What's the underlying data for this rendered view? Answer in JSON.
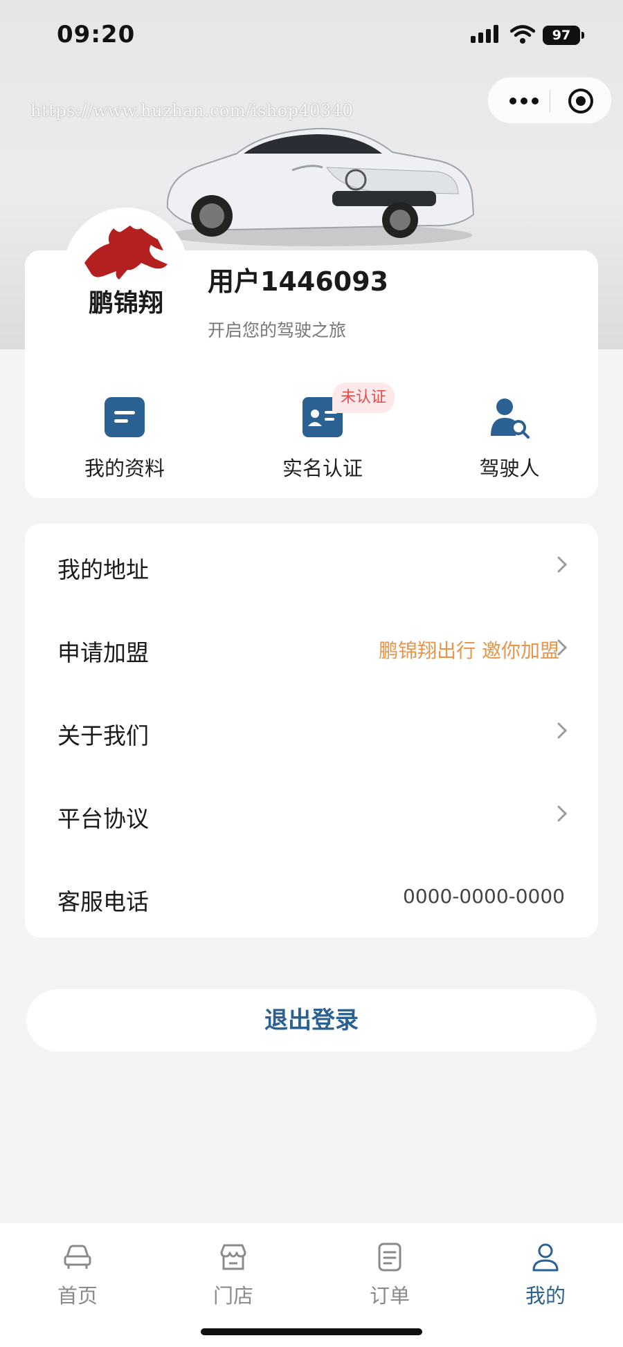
{
  "status_bar": {
    "time": "09:20",
    "battery": "97"
  },
  "header": {
    "watermark": "https://www.huzhan.com/ishop40340"
  },
  "profile": {
    "username": "用户1446093",
    "subtitle": "开启您的驾驶之旅",
    "logo_text": "鹏锦翔"
  },
  "shortcuts": [
    {
      "label": "我的资料"
    },
    {
      "label": "实名认证",
      "badge": "未认证"
    },
    {
      "label": "驾驶人"
    }
  ],
  "menu": [
    {
      "label": "我的地址",
      "value": ""
    },
    {
      "label": "申请加盟",
      "value": "鹏锦翔出行 邀你加盟"
    },
    {
      "label": "关于我们",
      "value": ""
    },
    {
      "label": "平台协议",
      "value": ""
    },
    {
      "label": "客服电话",
      "value": "0000-0000-0000"
    }
  ],
  "logout_label": "退出登录",
  "tabs": [
    {
      "label": "首页",
      "icon": "car-icon"
    },
    {
      "label": "门店",
      "icon": "store-icon"
    },
    {
      "label": "订单",
      "icon": "order-icon"
    },
    {
      "label": "我的",
      "icon": "user-icon"
    }
  ],
  "colors": {
    "accent": "#2b6192",
    "orange": "#e8944a",
    "badge_bg": "#fde8ea",
    "badge_text": "#e64a4a",
    "horse_red": "#b3201f"
  }
}
